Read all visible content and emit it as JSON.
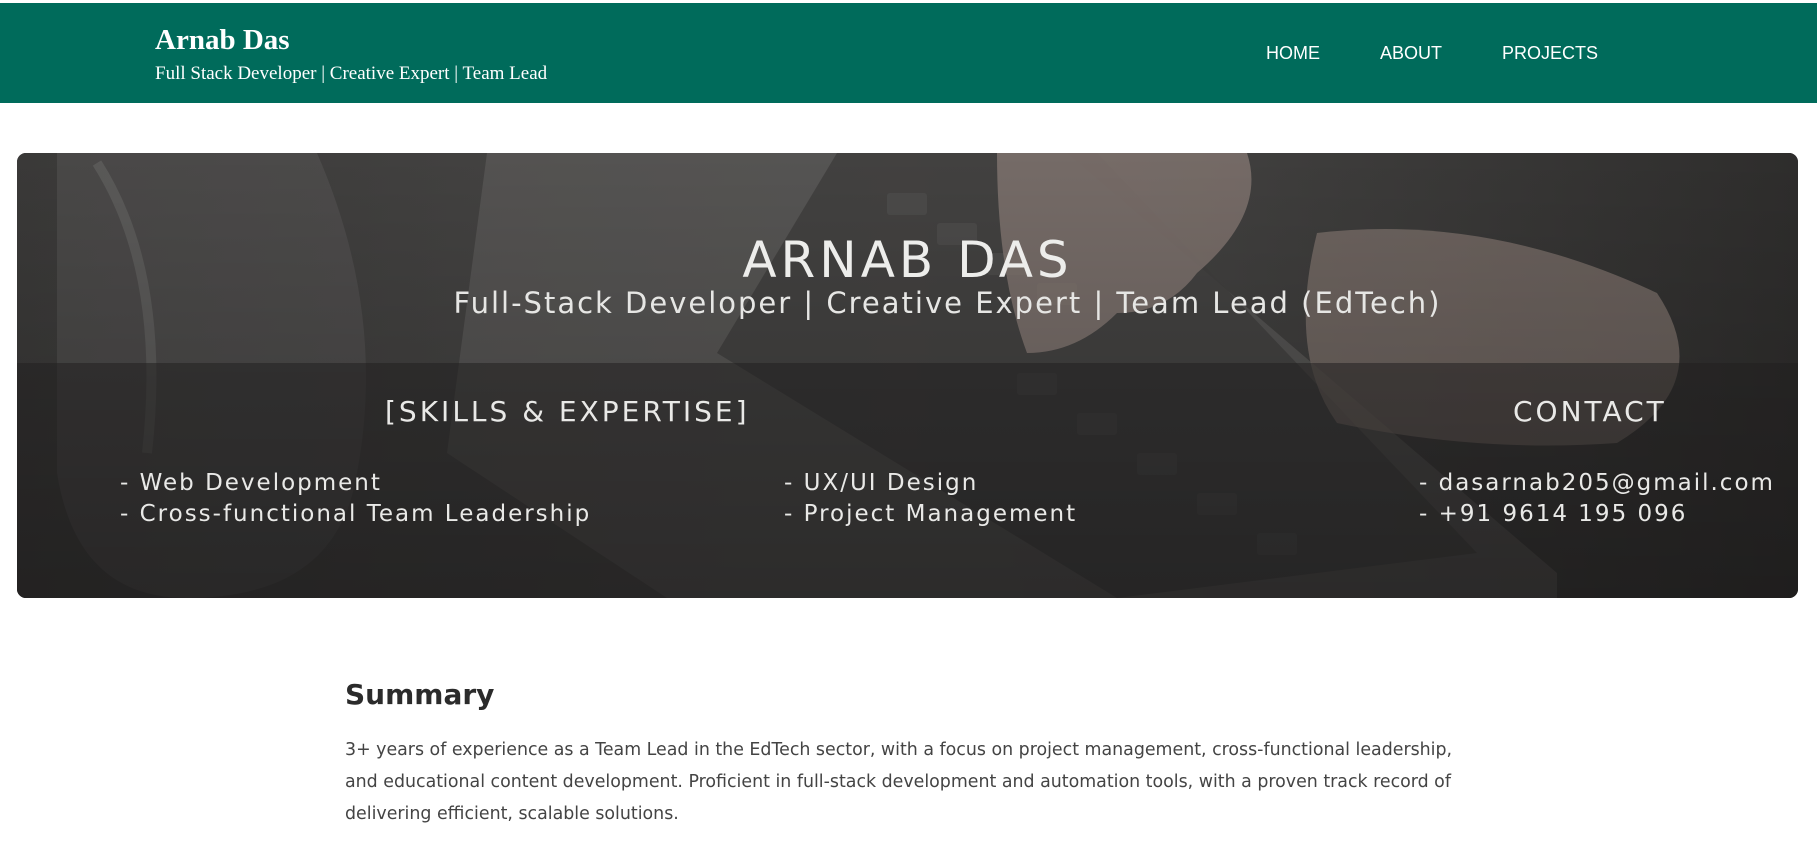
{
  "header": {
    "name": "Arnab Das",
    "tagline": "Full Stack Developer | Creative Expert | Team Lead",
    "nav": [
      "HOME",
      "ABOUT",
      "PROJECTS"
    ]
  },
  "hero": {
    "name": "ARNAB DAS",
    "role": "Full-Stack Developer | Creative Expert | Team Lead (EdTech)",
    "skills_title": "[SKILLS & EXPERTISE]",
    "contact_title": "CONTACT",
    "skills_left": [
      "- Web Development",
      "- Cross-functional Team Leadership"
    ],
    "skills_right": [
      "- UX/UI Design",
      "- Project Management"
    ],
    "contact": [
      "- dasarnab205@gmail.com",
      "- +91 9614 195 096"
    ]
  },
  "summary": {
    "title": "Summary",
    "body": "3+ years of experience as a Team Lead in the EdTech sector, with a focus on project management, cross-functional leadership, and educational content development. Proficient in full-stack development and automation tools, with a proven track record of delivering efficient, scalable solutions."
  },
  "colors": {
    "header_bg": "#006b5b",
    "hero_overlay": "#2b2a29",
    "text_dark": "#2d2d2d"
  },
  "icons": {
    "hero_image": "keyboard-hands-photo"
  }
}
